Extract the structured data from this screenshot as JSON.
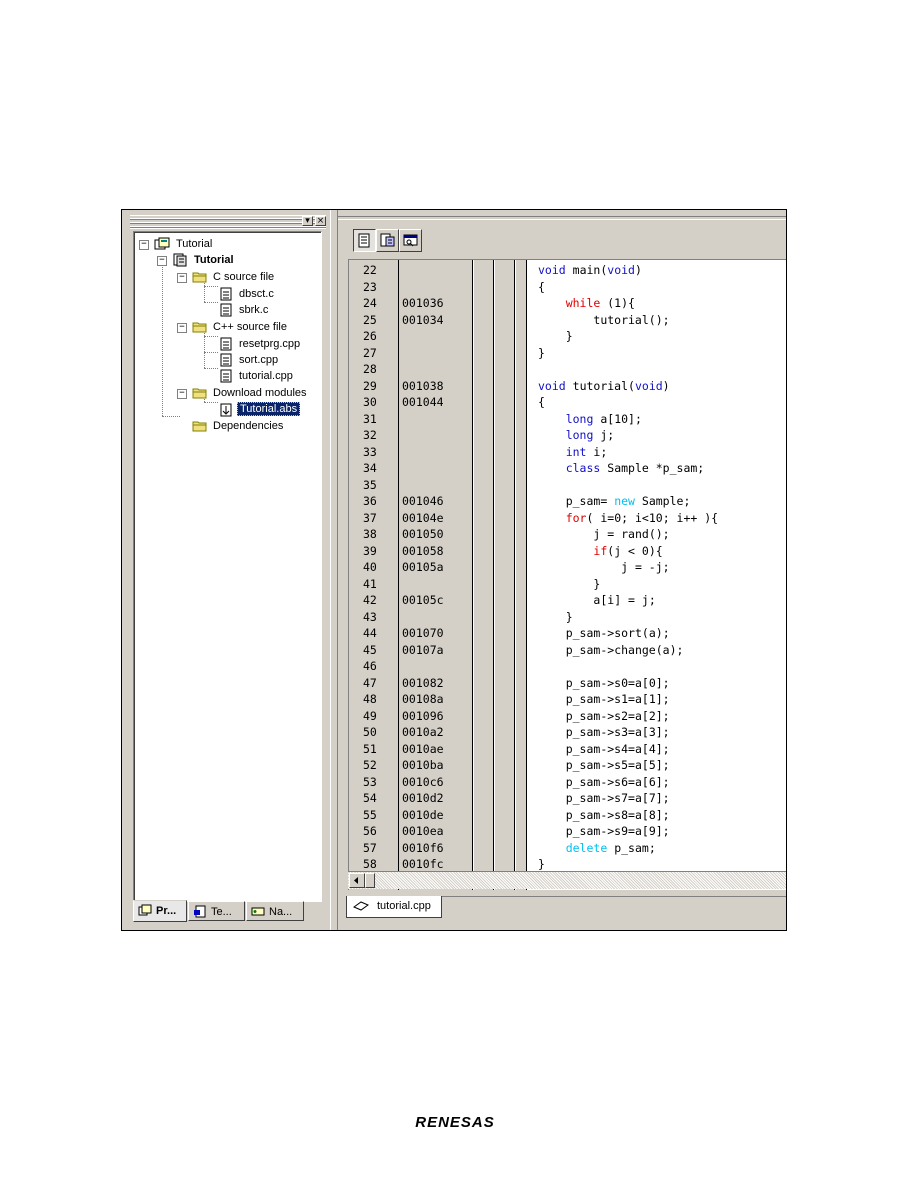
{
  "left_pane": {
    "tree": {
      "root": "Tutorial",
      "project": "Tutorial",
      "folders": [
        {
          "label": "C source file",
          "files": [
            "dbsct.c",
            "sbrk.c"
          ]
        },
        {
          "label": "C++ source file",
          "files": [
            "resetprg.cpp",
            "sort.cpp",
            "tutorial.cpp"
          ]
        },
        {
          "label": "Download modules",
          "files": [
            "Tutorial.abs"
          ]
        },
        {
          "label": "Dependencies",
          "files": []
        }
      ],
      "selected": "Tutorial.abs"
    },
    "tabs": [
      {
        "label": "Pr...",
        "icon": "projects-tab-icon",
        "active": true
      },
      {
        "label": "Te...",
        "icon": "templates-tab-icon",
        "active": false
      },
      {
        "label": "Na...",
        "icon": "navigation-tab-icon",
        "active": false
      }
    ],
    "title_buttons": [
      "float-button",
      "close-button"
    ]
  },
  "editor": {
    "toolbar_buttons": [
      "source-mode-icon",
      "mixed-mode-icon",
      "disassembly-mode-icon"
    ],
    "rows": [
      {
        "line": "22",
        "addr": "",
        "code": "void main(void)"
      },
      {
        "line": "23",
        "addr": "",
        "code": "{"
      },
      {
        "line": "24",
        "addr": "001036",
        "code": "    while (1){"
      },
      {
        "line": "25",
        "addr": "001034",
        "code": "        tutorial();"
      },
      {
        "line": "26",
        "addr": "",
        "code": "    }"
      },
      {
        "line": "27",
        "addr": "",
        "code": "}"
      },
      {
        "line": "28",
        "addr": "",
        "code": ""
      },
      {
        "line": "29",
        "addr": "001038",
        "code": "void tutorial(void)"
      },
      {
        "line": "30",
        "addr": "001044",
        "code": "{"
      },
      {
        "line": "31",
        "addr": "",
        "code": "    long a[10];"
      },
      {
        "line": "32",
        "addr": "",
        "code": "    long j;"
      },
      {
        "line": "33",
        "addr": "",
        "code": "    int i;"
      },
      {
        "line": "34",
        "addr": "",
        "code": "    class Sample *p_sam;"
      },
      {
        "line": "35",
        "addr": "",
        "code": ""
      },
      {
        "line": "36",
        "addr": "001046",
        "code": "    p_sam= new Sample;"
      },
      {
        "line": "37",
        "addr": "00104e",
        "code": "    for( i=0; i<10; i++ ){"
      },
      {
        "line": "38",
        "addr": "001050",
        "code": "        j = rand();"
      },
      {
        "line": "39",
        "addr": "001058",
        "code": "        if(j < 0){"
      },
      {
        "line": "40",
        "addr": "00105a",
        "code": "            j = -j;"
      },
      {
        "line": "41",
        "addr": "",
        "code": "        }"
      },
      {
        "line": "42",
        "addr": "00105c",
        "code": "        a[i] = j;"
      },
      {
        "line": "43",
        "addr": "",
        "code": "    }"
      },
      {
        "line": "44",
        "addr": "001070",
        "code": "    p_sam->sort(a);"
      },
      {
        "line": "45",
        "addr": "00107a",
        "code": "    p_sam->change(a);"
      },
      {
        "line": "46",
        "addr": "",
        "code": ""
      },
      {
        "line": "47",
        "addr": "001082",
        "code": "    p_sam->s0=a[0];"
      },
      {
        "line": "48",
        "addr": "00108a",
        "code": "    p_sam->s1=a[1];"
      },
      {
        "line": "49",
        "addr": "001096",
        "code": "    p_sam->s2=a[2];"
      },
      {
        "line": "50",
        "addr": "0010a2",
        "code": "    p_sam->s3=a[3];"
      },
      {
        "line": "51",
        "addr": "0010ae",
        "code": "    p_sam->s4=a[4];"
      },
      {
        "line": "52",
        "addr": "0010ba",
        "code": "    p_sam->s5=a[5];"
      },
      {
        "line": "53",
        "addr": "0010c6",
        "code": "    p_sam->s6=a[6];"
      },
      {
        "line": "54",
        "addr": "0010d2",
        "code": "    p_sam->s7=a[7];"
      },
      {
        "line": "55",
        "addr": "0010de",
        "code": "    p_sam->s8=a[8];"
      },
      {
        "line": "56",
        "addr": "0010ea",
        "code": "    p_sam->s9=a[9];"
      },
      {
        "line": "57",
        "addr": "0010f6",
        "code": "    delete p_sam;"
      },
      {
        "line": "58",
        "addr": "0010fc",
        "code": "}"
      }
    ],
    "keywords": {
      "red": [
        "while",
        "for",
        "if"
      ],
      "blue": [
        "void",
        "long",
        "int",
        "class"
      ],
      "cyan": [
        "new",
        "delete"
      ]
    },
    "doc_tab": "tutorial.cpp"
  },
  "footer": {
    "logo_text": "RENESAS"
  },
  "colors": {
    "chrome": "#d4d0c8",
    "selection": "#0a246a",
    "keyword_red": "#e00000",
    "keyword_blue": "#1010c8",
    "keyword_cyan": "#00c0f0"
  }
}
